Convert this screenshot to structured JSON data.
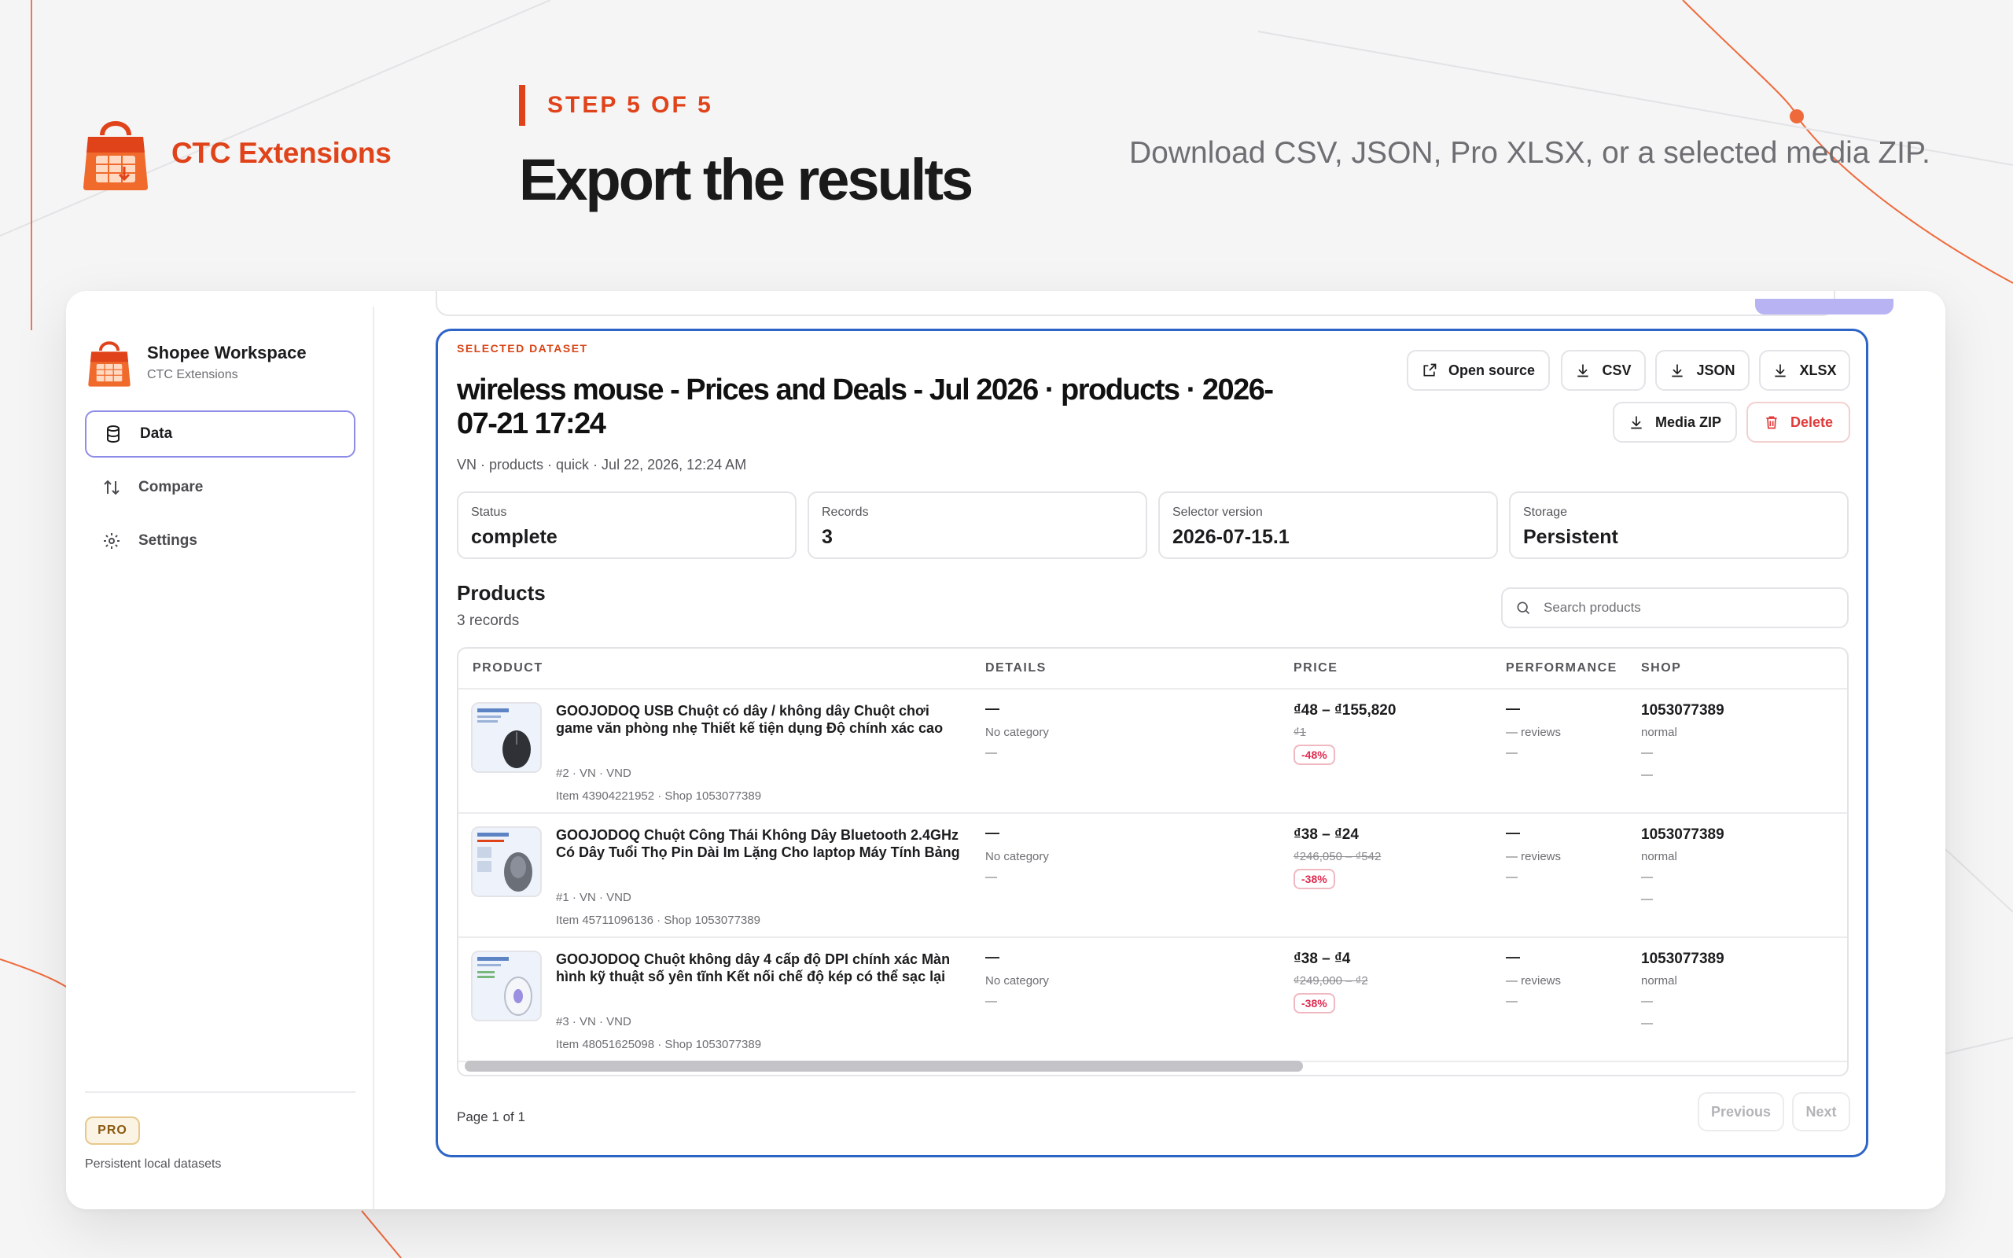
{
  "header": {
    "brand": "CTC Extensions",
    "step": "STEP 5 OF 5",
    "title": "Export the results",
    "description": "Download CSV, JSON, Pro XLSX, or a selected media ZIP."
  },
  "sidebar": {
    "workspace_title": "Shopee Workspace",
    "workspace_sub": "CTC Extensions",
    "items": [
      {
        "label": "Data",
        "icon": "database-icon",
        "active": true
      },
      {
        "label": "Compare",
        "icon": "compare-arrows-icon",
        "active": false
      },
      {
        "label": "Settings",
        "icon": "gear-icon",
        "active": false
      }
    ],
    "pro_badge": "PRO",
    "pro_desc": "Persistent local datasets"
  },
  "dataset": {
    "eyebrow": "SELECTED DATASET",
    "title": "wireless mouse - Prices and Deals - Jul 2026 · products · 2026-07-21 17:24",
    "meta": "VN · products · quick · Jul 22, 2026, 12:24 AM",
    "actions": {
      "open_source": "Open source",
      "csv": "CSV",
      "json": "JSON",
      "xlsx": "XLSX",
      "media_zip": "Media ZIP",
      "delete": "Delete"
    },
    "stats": [
      {
        "label": "Status",
        "value": "complete"
      },
      {
        "label": "Records",
        "value": "3"
      },
      {
        "label": "Selector version",
        "value": "2026-07-15.1"
      },
      {
        "label": "Storage",
        "value": "Persistent"
      }
    ]
  },
  "products": {
    "title": "Products",
    "count": "3 records",
    "search_placeholder": "Search products",
    "columns": [
      "PRODUCT",
      "DETAILS",
      "PRICE",
      "PERFORMANCE",
      "SHOP"
    ],
    "rows": [
      {
        "name": "GOOJODOQ USB Chuột có dây / không dây Chuột chơi game văn phòng nhẹ Thiết kế tiện dụng Độ chính xác cao",
        "id_line": "#2 · VN · VND",
        "item_line": "Item 43904221952 · Shop 1053077389",
        "details_dash": "—",
        "category": "No category",
        "details_dash2": "—",
        "price": "₫48 – ₫155,820",
        "old_price": "₫1",
        "discount": "-48%",
        "perf_dash": "—",
        "reviews": "— reviews",
        "perf_dash2": "—",
        "shop_id": "1053077389",
        "shop_type": "normal",
        "shop_dash1": "—",
        "shop_dash2": "—"
      },
      {
        "name": "GOOJODOQ Chuột Công Thái Không Dây Bluetooth 2.4GHz Có Dây Tuổi Thọ Pin Dài Im Lặng Cho laptop Máy Tính Bảng",
        "id_line": "#1 · VN · VND",
        "item_line": "Item 45711096136 · Shop 1053077389",
        "details_dash": "—",
        "category": "No category",
        "details_dash2": "—",
        "price": "₫38 – ₫24",
        "old_price": "₫246,050 – ₫542",
        "discount": "-38%",
        "perf_dash": "—",
        "reviews": "— reviews",
        "perf_dash2": "—",
        "shop_id": "1053077389",
        "shop_type": "normal",
        "shop_dash1": "—",
        "shop_dash2": "—"
      },
      {
        "name": "GOOJODOQ Chuột không dây 4 cấp độ DPI chính xác Màn hình kỹ thuật số yên tĩnh Kết nối chế độ kép có thể sạc lại",
        "id_line": "#3 · VN · VND",
        "item_line": "Item 48051625098 · Shop 1053077389",
        "details_dash": "—",
        "category": "No category",
        "details_dash2": "—",
        "price": "₫38 – ₫4",
        "old_price": "₫249,000 – ₫2",
        "discount": "-38%",
        "perf_dash": "—",
        "reviews": "— reviews",
        "perf_dash2": "—",
        "shop_id": "1053077389",
        "shop_type": "normal",
        "shop_dash1": "—",
        "shop_dash2": "—"
      }
    ],
    "page_info": "Page 1 of 1",
    "prev": "Previous",
    "next": "Next"
  },
  "colors": {
    "accent": "#e0431a",
    "card_border": "#2d64c8",
    "nav_active_border": "#8f8ce8",
    "danger": "#e03a3a"
  }
}
